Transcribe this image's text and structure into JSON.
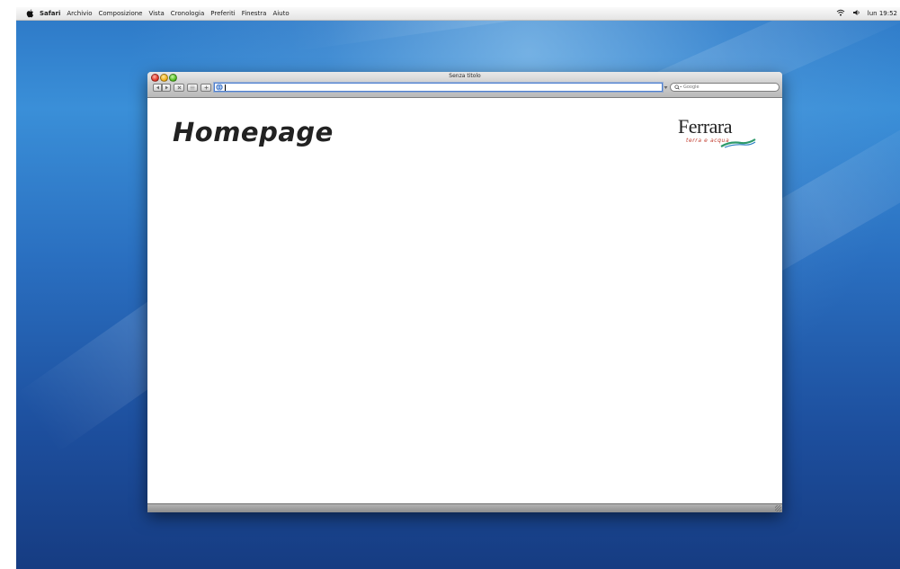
{
  "menubar": {
    "apple_icon": "apple-logo-icon",
    "app_name": "Safari",
    "items": [
      "Archivio",
      "Composizione",
      "Vista",
      "Cronologia",
      "Preferiti",
      "Finestra",
      "Aiuto"
    ],
    "status": {
      "wifi_icon": "wifi-icon",
      "volume_icon": "volume-icon",
      "clock": "lun 19:52"
    }
  },
  "window": {
    "title": "Senza titolo",
    "toolbar": {
      "back_icon": "back-arrow-icon",
      "forward_icon": "forward-arrow-icon",
      "stop_icon": "stop-x-icon",
      "bookmark_icon": "bookmark-icon",
      "add_bookmark_icon": "plus-icon",
      "url": {
        "value": "",
        "site_icon": "globe-icon"
      },
      "search": {
        "placeholder": "Google",
        "icon": "magnifier-icon"
      }
    },
    "page": {
      "heading": "Homepage",
      "logo": {
        "name": "Ferrara",
        "tagline": "terra e acqua"
      }
    }
  },
  "colors": {
    "desktop_blue": "#2a6fc0",
    "url_focus": "#4d7fcf",
    "close": "#e2392b",
    "minimize": "#f2b21d",
    "zoom": "#55c124",
    "logo_red": "#c0392b",
    "logo_green": "#2e9a6b"
  }
}
